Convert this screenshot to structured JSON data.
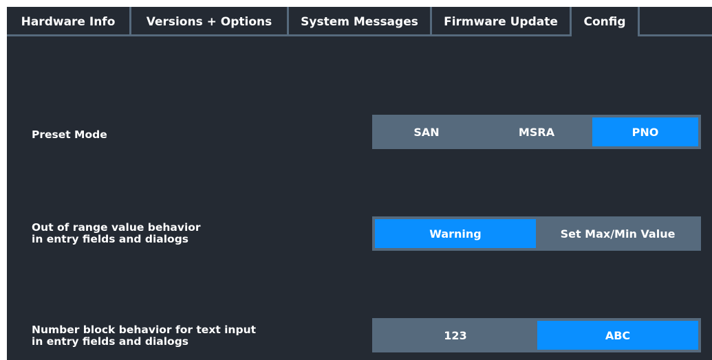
{
  "tabs": [
    {
      "label": "Hardware Info"
    },
    {
      "label": "Versions + Options"
    },
    {
      "label": "System Messages"
    },
    {
      "label": "Firmware Update"
    },
    {
      "label": "Config"
    }
  ],
  "active_tab": "Config",
  "settings": {
    "preset_mode": {
      "label": "Preset Mode",
      "options": [
        "SAN",
        "MSRA",
        "PNO"
      ],
      "selected": "PNO"
    },
    "out_of_range": {
      "label_line1": "Out of range value behavior",
      "label_line2": "in entry fields and dialogs",
      "options": [
        "Warning",
        "Set Max/Min Value"
      ],
      "selected": "Warning"
    },
    "number_block": {
      "label_line1": "Number block behavior for text input",
      "label_line2": "in entry fields and dialogs",
      "options": [
        "123",
        "ABC"
      ],
      "selected": "ABC"
    }
  },
  "colors": {
    "background": "#242a33",
    "segment_bg": "#566a7d",
    "selected_accent": "#0a8fff",
    "text": "#ffffff"
  }
}
